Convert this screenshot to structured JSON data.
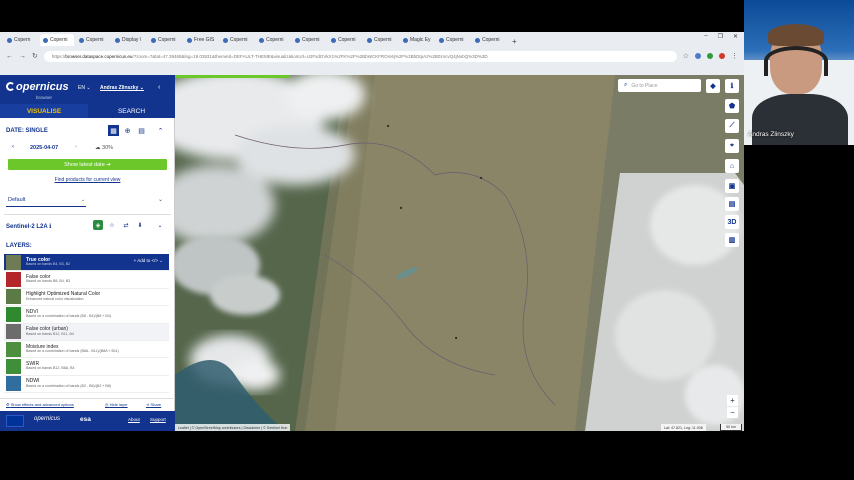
{
  "browser": {
    "tabs": [
      "Copern",
      "Coperni",
      "Coperni",
      "Display \\",
      "Coperni",
      "Free GIS",
      "Coperni",
      "Coperni",
      "Coperni",
      "Coperni",
      "Coperni",
      "Magic Ey",
      "Coperni",
      "Coperni"
    ],
    "active_tab_index": 1,
    "url_host": "browser.dataspace.copernicus.eu",
    "url_rest": "/?zoom=7&lat=47.39468&lng=19.03931&themeId=DEFAULT-THEME&visualizationUrl=U2FsdGVkX1%2FK%2F%2BbWCKFROm6j%2F%2BbDtpAz%2B0zncvQ4jNxbQ%3D%3D"
  },
  "webcam": {
    "name": "Andras Zlinszky"
  },
  "sidebar": {
    "logo": "opernicus",
    "logo_sub": "browser",
    "lang": "EN",
    "user": "Andras Zlinszky",
    "tabs": {
      "visualise": "VISUALISE",
      "search": "SEARCH"
    },
    "date_mode": "DATE: SINGLE",
    "date_value": "2025-04-07",
    "cloud_cover": "30%",
    "show_latest": "Show latest date",
    "find_products": "Find products for current view",
    "theme": "Default",
    "collection": "Sentinel-2 L2A",
    "layers_title": "LAYERS:",
    "add_to": "Add to",
    "layers": [
      {
        "name": "True color",
        "desc": "Based on bands B4, B3, B2",
        "color": "#6f7b55"
      },
      {
        "name": "False color",
        "desc": "Based on bands B8, B4, B3",
        "color": "#b3262a"
      },
      {
        "name": "Highlight Optimized Natural Color",
        "desc": "Enhanced natural color visualization",
        "color": "#5c7a45"
      },
      {
        "name": "NDVI",
        "desc": "Based on a combination of bands (B8 - B4)/(B8 + B4)",
        "color": "#2f8a2f"
      },
      {
        "name": "False color (urban)",
        "desc": "Based on bands B12, B11, B4",
        "color": "#6c6c6c"
      },
      {
        "name": "Moisture index",
        "desc": "Based on a combination of bands (B8A - B11)/(B8A + B11)",
        "color": "#4e8e3f"
      },
      {
        "name": "SWIR",
        "desc": "Based on bands B12, B8A, B4",
        "color": "#3f8f3a"
      },
      {
        "name": "NDWI",
        "desc": "Based on a combination of bands (B3 - B8)/(B3 + B8)",
        "color": "#2f6e9e"
      }
    ],
    "effects_link": "Show effects and advanced options",
    "hide_layer": "Hide layer",
    "share": "Share",
    "footer": {
      "copernicus": "opernicus",
      "esa": "esa",
      "about": "About",
      "support": "Support"
    }
  },
  "map": {
    "search_placeholder": "Go to Place",
    "attribution": "Leaflet | © OpenStreetMap contributors | Disclaimer | © Sentinel Hub",
    "coords": "Lat: 47.821, Lng: 11.008",
    "scale": "50 km",
    "progress_fraction": 0.2
  }
}
